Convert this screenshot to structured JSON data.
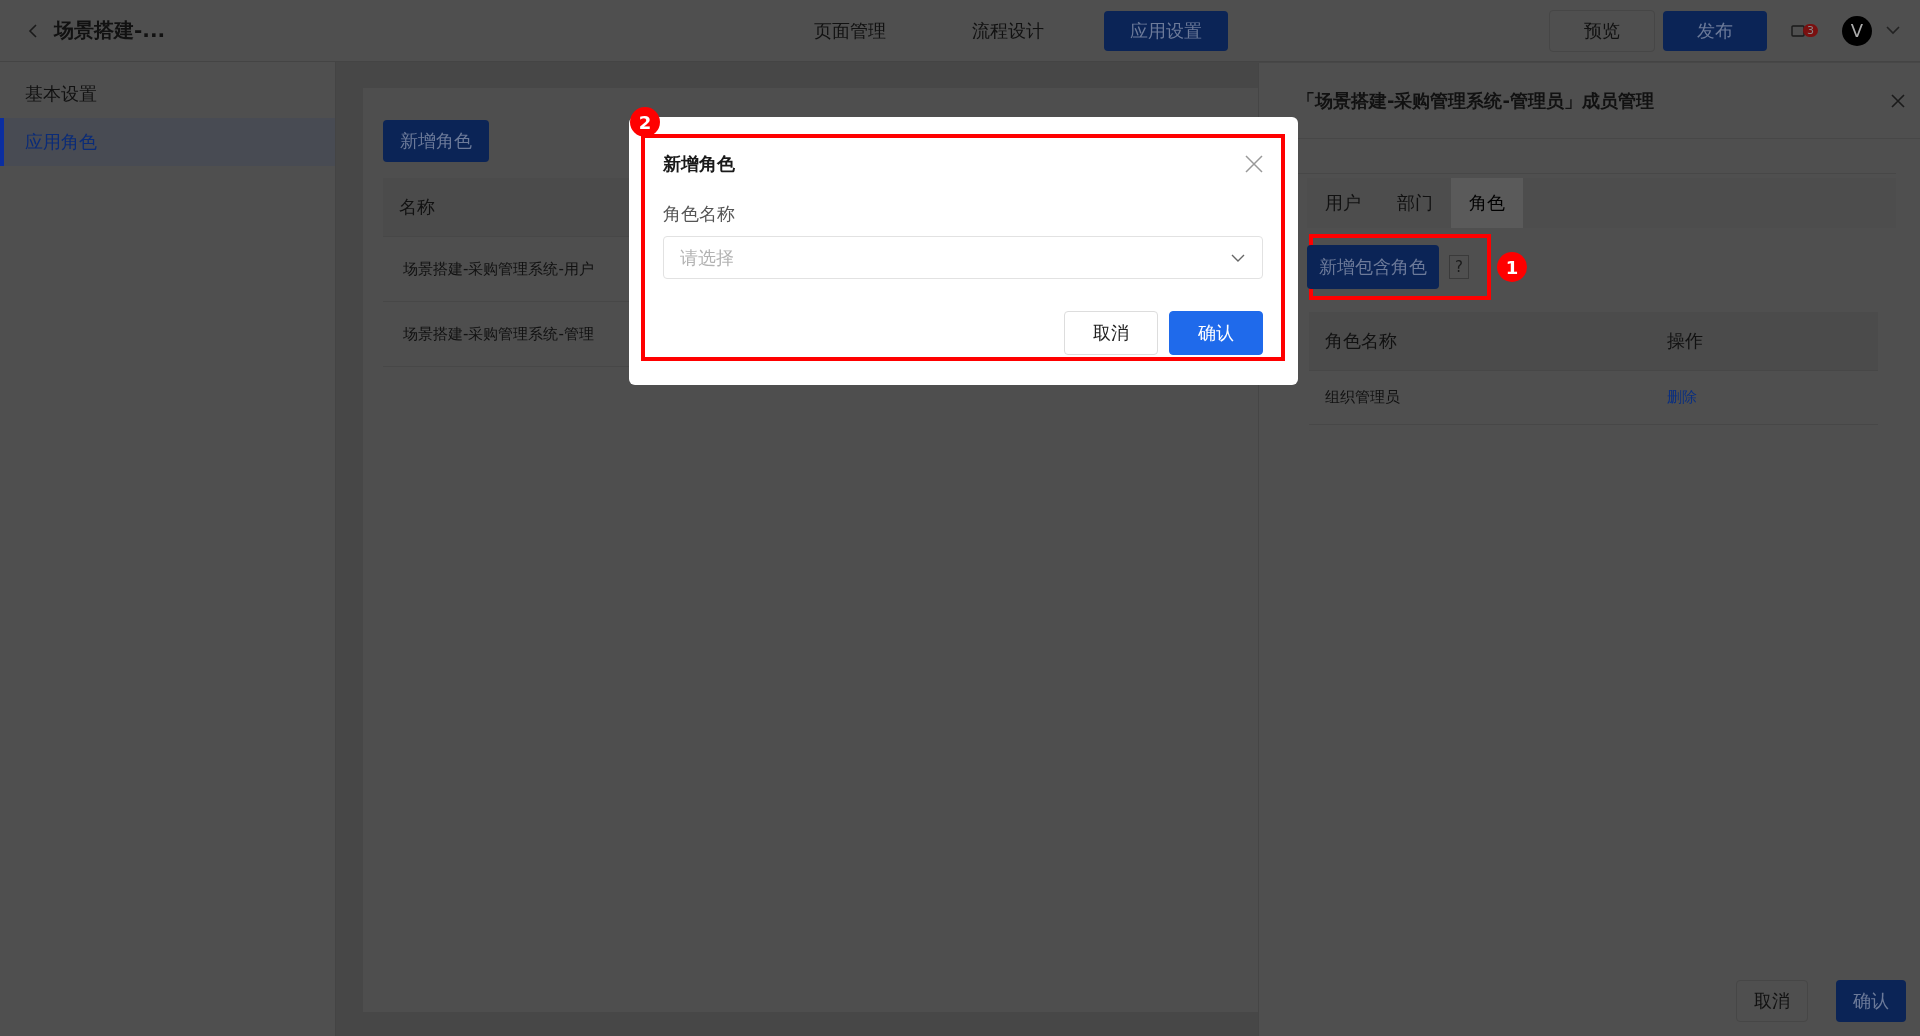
{
  "topbar": {
    "title": "场景搭建-...",
    "nav": [
      {
        "label": "页面管理",
        "selected": false
      },
      {
        "label": "流程设计",
        "selected": false
      },
      {
        "label": "应用设置",
        "selected": true
      }
    ],
    "preview": "预览",
    "publish": "发布",
    "notification_count": "3",
    "avatar": "V"
  },
  "sidebar": {
    "items": [
      {
        "label": "基本设置",
        "selected": false
      },
      {
        "label": "应用角色",
        "selected": true
      }
    ]
  },
  "main": {
    "add_button": "新增角色",
    "table": {
      "columns": [
        "名称"
      ],
      "rows": [
        [
          "场景搭建-采购管理系统-用户"
        ],
        [
          "场景搭建-采购管理系统-管理"
        ]
      ]
    }
  },
  "drawer": {
    "title": "「场景搭建-采购管理系统-管理员」成员管理",
    "tabs": [
      {
        "label": "用户",
        "selected": false
      },
      {
        "label": "部门",
        "selected": false
      },
      {
        "label": "角色",
        "selected": true
      }
    ],
    "add_button": "新增包含角色",
    "help": "?",
    "table": {
      "columns": [
        "角色名称",
        "操作"
      ],
      "rows": [
        {
          "name": "组织管理员",
          "action": "删除"
        }
      ]
    },
    "cancel": "取消",
    "confirm": "确认"
  },
  "dialog": {
    "title": "新增角色",
    "field_label": "角色名称",
    "placeholder": "请选择",
    "cancel": "取消",
    "confirm": "确认"
  },
  "annotations": [
    {
      "label": "1"
    },
    {
      "label": "2"
    }
  ]
}
